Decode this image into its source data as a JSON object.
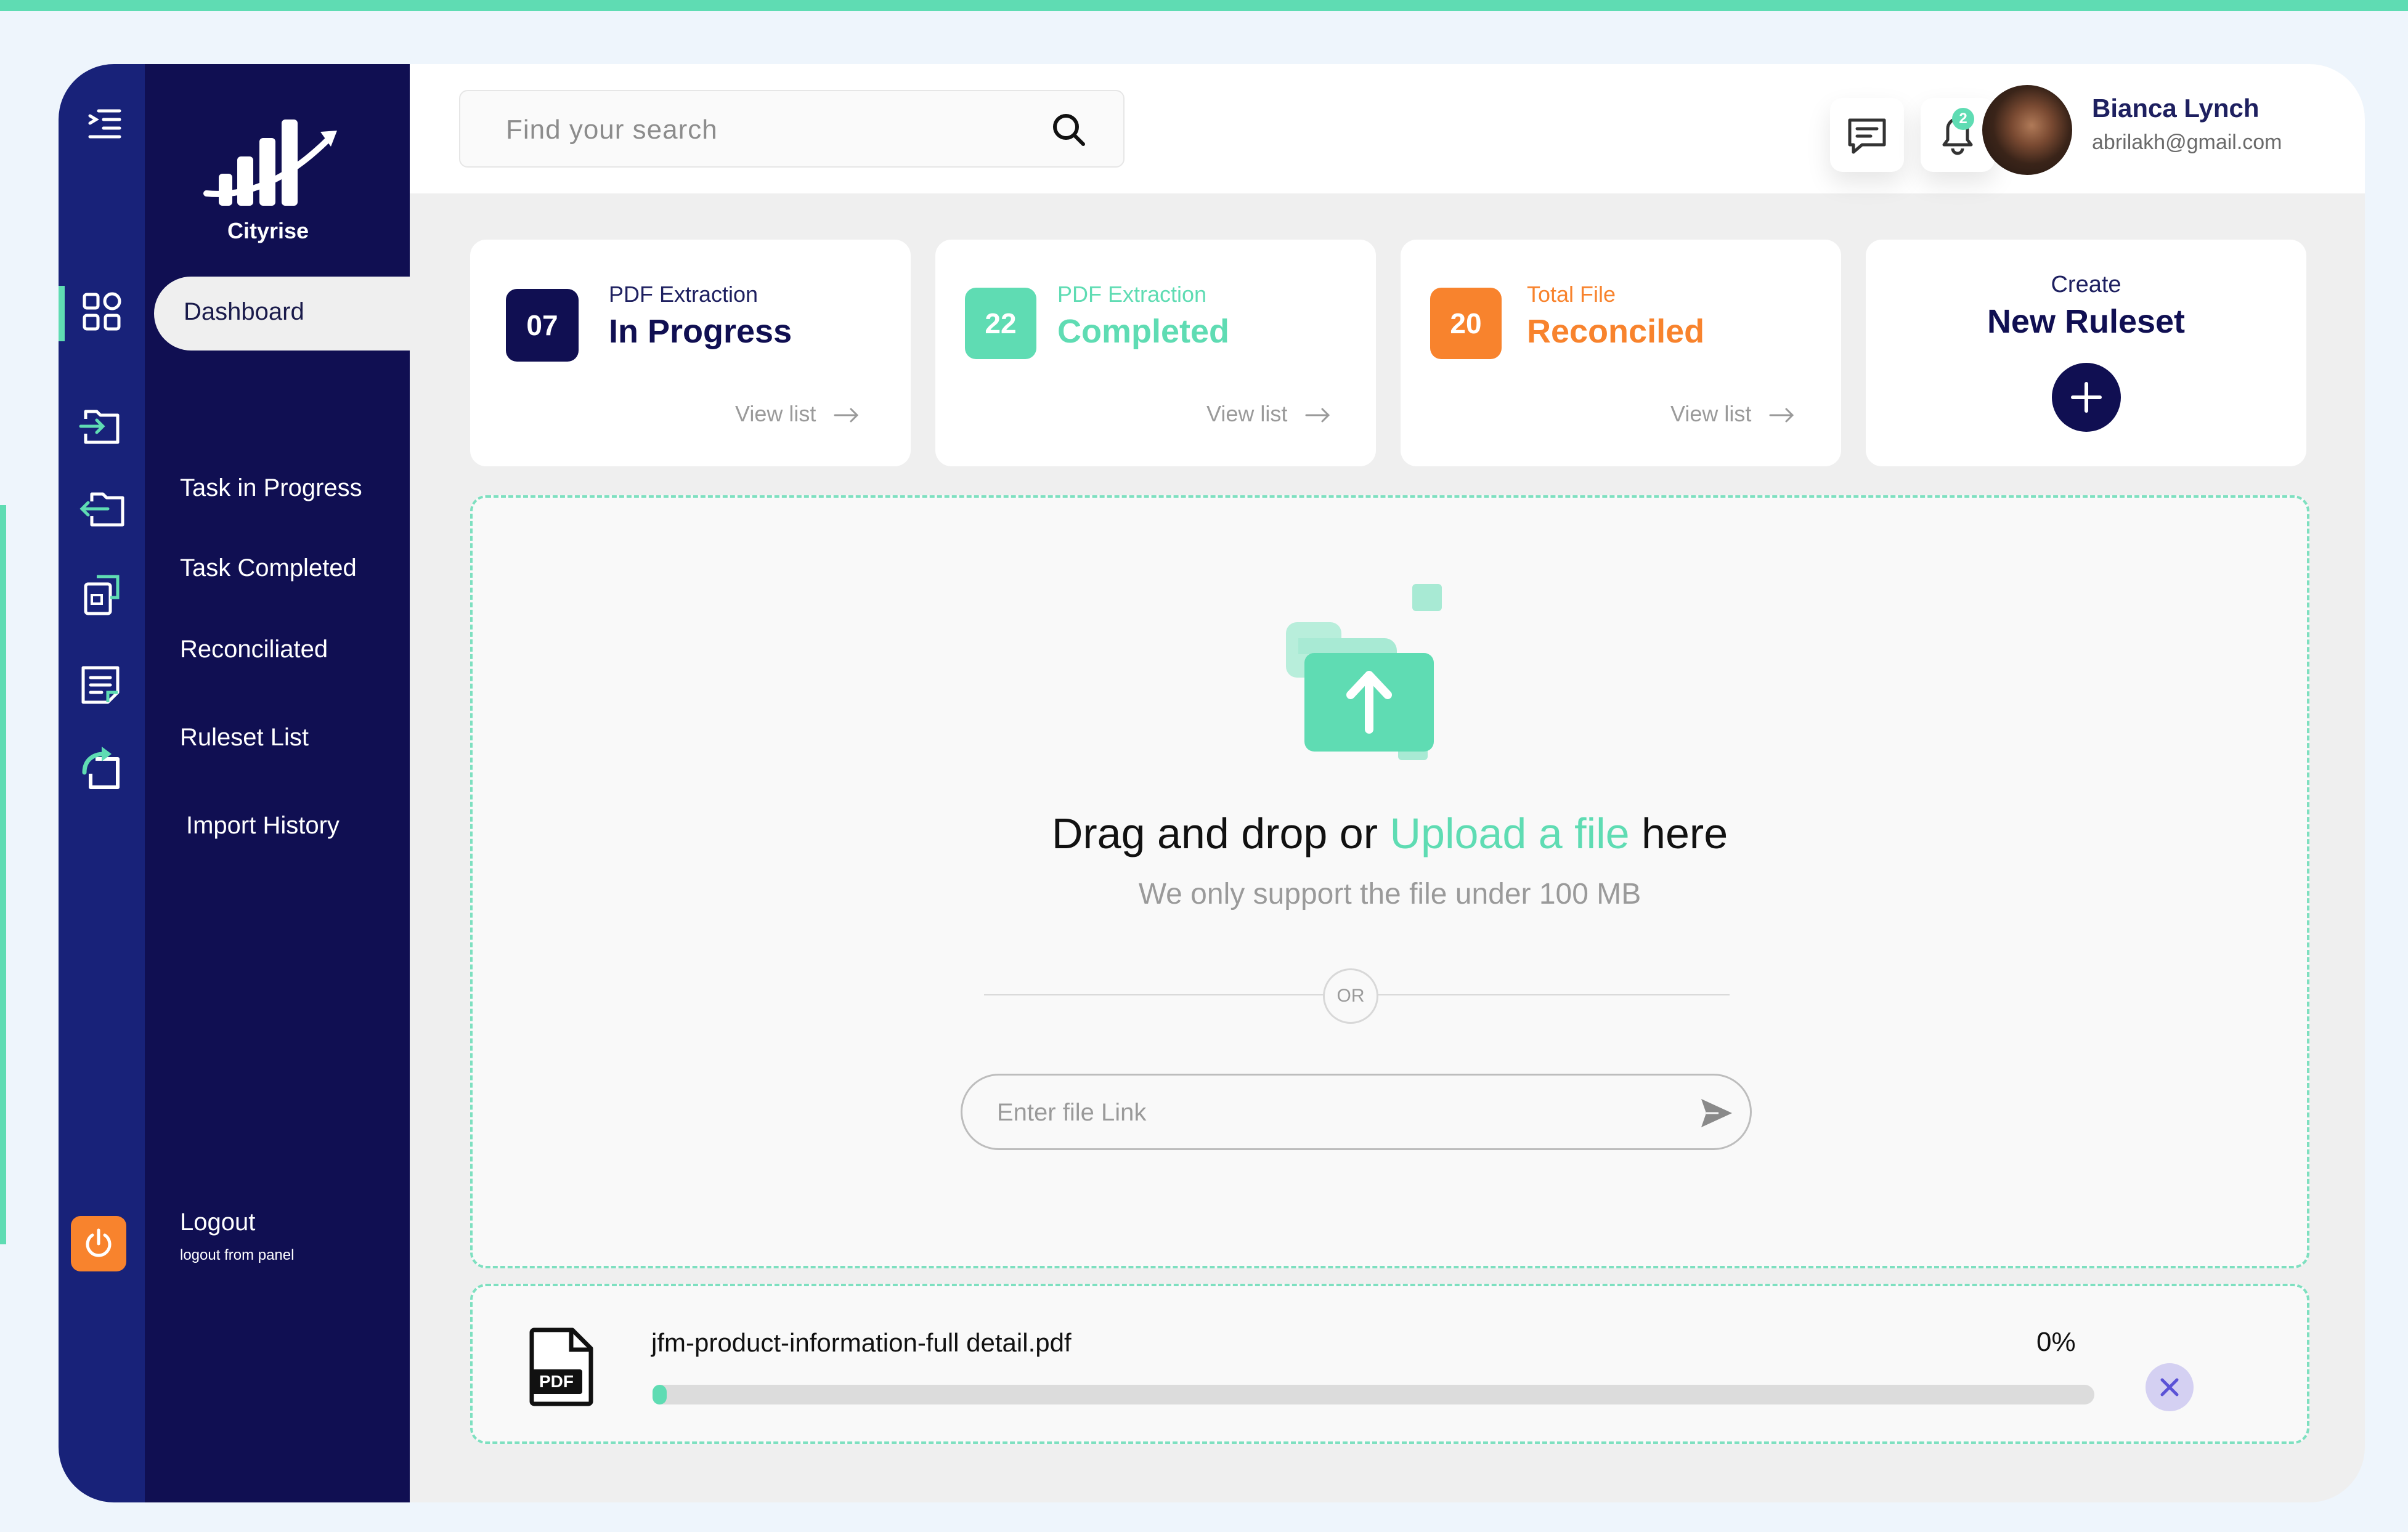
{
  "brand": {
    "logo_text": "Cityrise"
  },
  "sidebar": {
    "items": [
      {
        "label": "Dashboard",
        "icon": "dashboard-grid-icon",
        "active": true
      },
      {
        "label": "Task in Progress",
        "icon": "folder-import-icon"
      },
      {
        "label": "Task Completed",
        "icon": "folder-export-icon"
      },
      {
        "label": "Reconciliated",
        "icon": "puzzle-document-icon"
      },
      {
        "label": "Ruleset List",
        "icon": "list-document-icon"
      },
      {
        "label": "Import History",
        "icon": "history-import-icon"
      }
    ],
    "logout": {
      "label": "Logout",
      "sublabel": "logout from panel",
      "icon": "power-icon"
    }
  },
  "header": {
    "search": {
      "placeholder": "Find your search",
      "icon": "search-icon"
    },
    "notifications_count": "2",
    "user": {
      "name": "Bianca Lynch",
      "email": "abrilakh@gmail.com"
    }
  },
  "cards": [
    {
      "badge": "07",
      "subtitle": "PDF Extraction",
      "title": "In Progress",
      "link": "View list",
      "color": "#100f52"
    },
    {
      "badge": "22",
      "subtitle": "PDF Extraction",
      "title": "Completed",
      "link": "View list",
      "color": "#5fdcb3"
    },
    {
      "badge": "20",
      "subtitle": "Total File",
      "title": "Reconciled",
      "link": "View list",
      "color": "#f8832d"
    }
  ],
  "create_card": {
    "subtitle": "Create",
    "title": "New Ruleset"
  },
  "upload": {
    "title_prefix": "Drag and drop or ",
    "title_link": "Upload a file",
    "title_suffix": " here",
    "subtitle": "We only support the file under 100 MB",
    "or_label": "OR",
    "link_placeholder": "Enter file Link"
  },
  "file": {
    "name": "jfm-product-information-full detail.pdf",
    "progress_label": "0%",
    "progress": 0.01,
    "type_label": "PDF"
  },
  "colors": {
    "accent": "#5fdcb3",
    "navy": "#100f52",
    "orange": "#f8832d"
  }
}
